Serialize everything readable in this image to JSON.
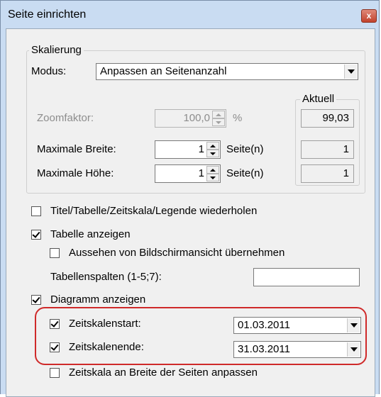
{
  "window": {
    "title": "Seite einrichten",
    "close_label": "x"
  },
  "scaling": {
    "legend": "Skalierung",
    "mode_label": "Modus:",
    "mode_value": "Anpassen an Seitenanzahl",
    "current_legend": "Aktuell",
    "zoom_label": "Zoomfaktor:",
    "zoom_value": "100,0",
    "zoom_unit": "%",
    "zoom_current": "99,03",
    "max_width_label": "Maximale Breite:",
    "max_width_value": "1",
    "max_width_unit": "Seite(n)",
    "max_width_current": "1",
    "max_height_label": "Maximale Höhe:",
    "max_height_value": "1",
    "max_height_unit": "Seite(n)",
    "max_height_current": "1"
  },
  "options": {
    "repeat_label": "Titel/Tabelle/Zeitskala/Legende wiederholen",
    "repeat_checked": false,
    "show_table_label": "Tabelle anzeigen",
    "show_table_checked": true,
    "screen_look_label": "Aussehen von Bildschirmansicht übernehmen",
    "screen_look_checked": false,
    "table_columns_label": "Tabellenspalten (1-5;7):",
    "table_columns_value": "",
    "show_chart_label": "Diagramm anzeigen",
    "show_chart_checked": true,
    "timescale_start_label": "Zeitskalenstart:",
    "timescale_start_checked": true,
    "timescale_start_value": "01.03.2011",
    "timescale_end_label": "Zeitskalenende:",
    "timescale_end_checked": true,
    "timescale_end_value": "31.03.2011",
    "fit_timescale_label": "Zeitskala an Breite der Seiten anpassen",
    "fit_timescale_checked": false
  },
  "colors": {
    "highlight": "#cf2a2a",
    "titlebar": "#c9dcf2",
    "close_button": "#c2422c"
  }
}
